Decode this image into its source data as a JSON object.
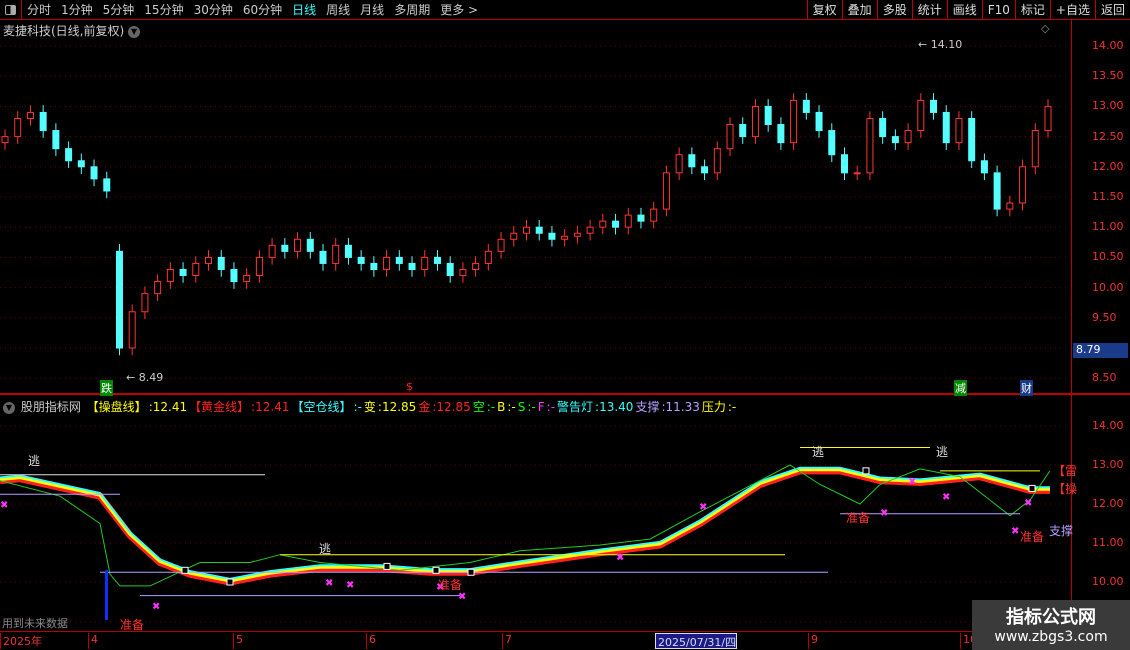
{
  "toolbar": {
    "periods": [
      "分时",
      "1分钟",
      "5分钟",
      "15分钟",
      "30分钟",
      "60分钟",
      "日线",
      "周线",
      "月线",
      "多周期",
      "更多 >"
    ],
    "active": "日线",
    "buttons": [
      "复权",
      "叠加",
      "多股",
      "统计",
      "画线",
      "F10",
      "标记",
      "+自选",
      "返回"
    ]
  },
  "stock_title": "麦捷科技(日线,前复权)",
  "upper_axis": [
    "14.00",
    "13.50",
    "13.00",
    "12.50",
    "12.00",
    "11.50",
    "11.00",
    "10.50",
    "10.00",
    "9.50",
    "9.00",
    "8.50"
  ],
  "current_price": "8.79",
  "high_label": "14.10",
  "low_label": "8.49",
  "event_markers": [
    "跌",
    "$",
    "减",
    "财"
  ],
  "indicator": {
    "name": "股朋指标网",
    "items": [
      {
        "label": "【操盘线】",
        "value": ":12.41",
        "color": "#ffff00"
      },
      {
        "label": "【黄金线】",
        "value": ":12.41",
        "color": "#ff2020"
      },
      {
        "label": "【空仓线】",
        "value": ":-",
        "color": "#33ffff"
      },
      {
        "label": "变",
        "value": ":12.85",
        "color": "#ffff00"
      },
      {
        "label": "金",
        "value": ":12.85",
        "color": "#ff2020"
      },
      {
        "label": "空",
        "value": ":-",
        "color": "#00ff00"
      },
      {
        "label": "B",
        "value": ":-",
        "color": "#ffff00"
      },
      {
        "label": "S",
        "value": ":-",
        "color": "#00ff00"
      },
      {
        "label": "F",
        "value": ":-",
        "color": "#ff33ff"
      },
      {
        "label": "警告灯",
        "value": ":13.40",
        "color": "#33ffff"
      },
      {
        "label": "支撑",
        "value": ":11.33",
        "color": "#b8a0ff"
      },
      {
        "label": "压力",
        "value": ":-",
        "color": "#ffff00"
      }
    ]
  },
  "lower_axis": [
    "14.00",
    "13.00",
    "12.00",
    "11.00",
    "10.00"
  ],
  "signals": {
    "escape": "逃",
    "prepare": "准备",
    "support": "支撑",
    "thunder": "【雷",
    "operate": "【操"
  },
  "future_note": "用到未来数据",
  "time_axis": [
    "2025年",
    "4",
    "5",
    "6",
    "7",
    "2025/07/31/四",
    "9",
    "10"
  ],
  "watermark": {
    "title": "指标公式网",
    "url": "www.zbgs3.com"
  },
  "chart_data": {
    "type": "candlestick",
    "closes": [
      12.5,
      12.8,
      12.9,
      12.6,
      12.3,
      12.1,
      12.0,
      11.8,
      11.6,
      9.0,
      9.6,
      9.9,
      10.1,
      10.3,
      10.2,
      10.4,
      10.5,
      10.3,
      10.1,
      10.2,
      10.5,
      10.7,
      10.6,
      10.8,
      10.6,
      10.4,
      10.7,
      10.5,
      10.4,
      10.3,
      10.5,
      10.4,
      10.3,
      10.5,
      10.4,
      10.2,
      10.3,
      10.4,
      10.6,
      10.8,
      10.9,
      11.0,
      10.9,
      10.8,
      10.85,
      10.9,
      11.0,
      11.1,
      11.0,
      11.2,
      11.1,
      11.3,
      11.9,
      12.2,
      12.0,
      11.9,
      12.3,
      12.7,
      12.5,
      13.0,
      12.7,
      12.4,
      13.1,
      12.9,
      12.6,
      12.2,
      11.9,
      11.9,
      12.8,
      12.5,
      12.4,
      12.6,
      13.1,
      12.9,
      12.4,
      12.8,
      12.1,
      11.9,
      11.3,
      11.4,
      12.0,
      12.6,
      13.0
    ],
    "ribbon": [
      [
        0,
        12.6
      ],
      [
        20,
        12.65
      ],
      [
        100,
        12.2
      ],
      [
        130,
        11.2
      ],
      [
        160,
        10.5
      ],
      [
        190,
        10.2
      ],
      [
        230,
        10.0
      ],
      [
        270,
        10.2
      ],
      [
        320,
        10.35
      ],
      [
        380,
        10.35
      ],
      [
        430,
        10.25
      ],
      [
        470,
        10.25
      ],
      [
        520,
        10.45
      ],
      [
        600,
        10.75
      ],
      [
        660,
        10.95
      ],
      [
        700,
        11.5
      ],
      [
        760,
        12.5
      ],
      [
        800,
        12.85
      ],
      [
        840,
        12.85
      ],
      [
        880,
        12.6
      ],
      [
        920,
        12.55
      ],
      [
        980,
        12.7
      ],
      [
        1030,
        12.35
      ],
      [
        1050,
        12.35
      ]
    ],
    "fast": [
      [
        0,
        12.6
      ],
      [
        60,
        12.2
      ],
      [
        100,
        11.5
      ],
      [
        110,
        10.2
      ],
      [
        120,
        9.9
      ],
      [
        150,
        9.9
      ],
      [
        200,
        10.5
      ],
      [
        250,
        10.5
      ],
      [
        280,
        10.7
      ],
      [
        320,
        10.5
      ],
      [
        400,
        10.3
      ],
      [
        470,
        10.5
      ],
      [
        520,
        10.8
      ],
      [
        600,
        10.95
      ],
      [
        650,
        11.1
      ],
      [
        700,
        11.8
      ],
      [
        760,
        12.6
      ],
      [
        790,
        13.0
      ],
      [
        820,
        12.5
      ],
      [
        860,
        12.0
      ],
      [
        880,
        12.5
      ],
      [
        920,
        12.9
      ],
      [
        960,
        12.7
      ],
      [
        990,
        12.1
      ],
      [
        1010,
        11.7
      ],
      [
        1030,
        12.1
      ],
      [
        1050,
        12.85
      ]
    ]
  }
}
